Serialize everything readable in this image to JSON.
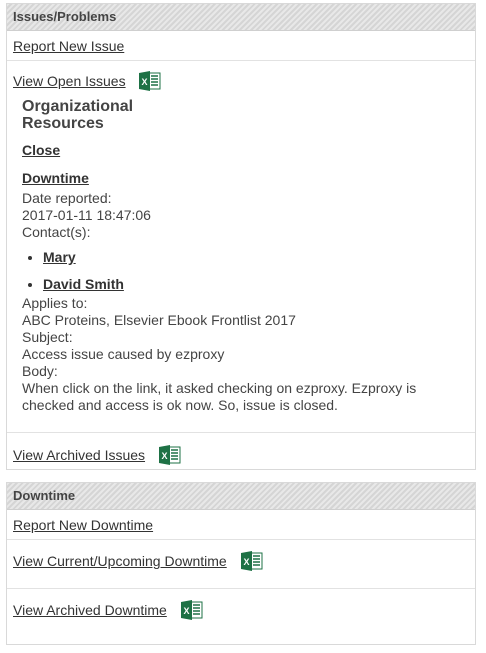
{
  "issues": {
    "header": "Issues/Problems",
    "report_new": "Report New Issue",
    "view_open": "View Open Issues",
    "view_archived": "View Archived Issues",
    "open_issue": {
      "org_title": "Organizational Resources",
      "close_link": "Close",
      "type_link": "Downtime",
      "date_label": "Date reported:",
      "date_value": "2017-01-11 18:47:06",
      "contacts_label": "Contact(s):",
      "contacts": [
        "Mary",
        "David Smith"
      ],
      "applies_label": "Applies to:",
      "applies_value": "ABC Proteins, Elsevier Ebook Frontlist 2017",
      "subject_label": "Subject:",
      "subject_value": "Access issue caused by ezproxy",
      "body_label": "Body:",
      "body_value": "When click on the link, it asked checking on ezproxy. Ezproxy is checked and access is ok now. So, issue is closed."
    }
  },
  "downtime": {
    "header": "Downtime",
    "report_new": "Report New Downtime",
    "view_current": "View Current/Upcoming Downtime",
    "view_archived": "View Archived Downtime"
  },
  "icons": {
    "excel": "excel-export-icon"
  },
  "colors": {
    "excel_green": "#1e7145",
    "header_bg": "#dcdcdc"
  }
}
